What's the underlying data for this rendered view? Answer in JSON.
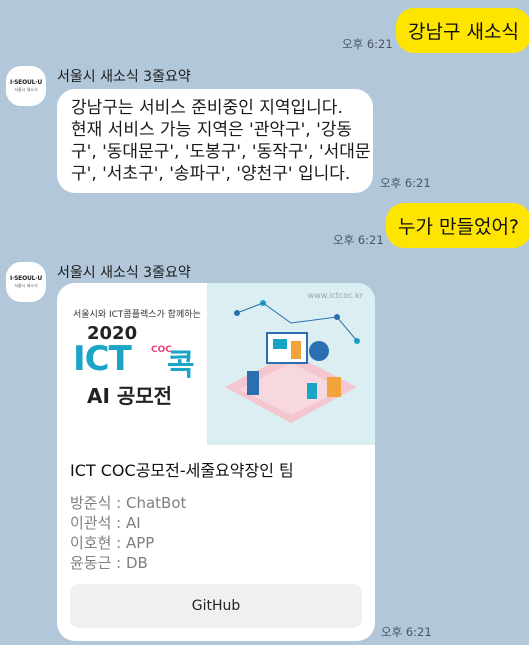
{
  "messages": {
    "me1": {
      "text": "강남구 새소식",
      "time": "오후 6:21"
    },
    "bot1": {
      "sender": "서울시 새소식 3줄요약",
      "lines": [
        "강남구는 서비스 준비중인 지역입니다.",
        "현재 서비스 가능 지역은 '관악구', '강동",
        "구', '동대문구', '도봉구', '동작구', '서대문",
        "구', '서초구', '송파구', '양천구' 입니다."
      ],
      "time": "오후 6:21"
    },
    "me2": {
      "text": "누가 만들었어?",
      "time": "오후 6:21"
    },
    "bot2": {
      "sender": "서울시 새소식 3줄요약",
      "banner": {
        "url": "www.ictcoc.kr",
        "subtitle": "서울시와 ICT콤플렉스가 함께하는",
        "year": "2020",
        "ict": "ICT",
        "coc": "COC",
        "kong": "콕",
        "ai": "AI 공모전"
      },
      "card_title": "ICT COC공모전-세줄요약장인 팀",
      "members": [
        "방준식 : ChatBot",
        "이관석 : AI",
        "이호현 : APP",
        "윤동근 : DB"
      ],
      "button_label": "GitHub",
      "time": "오후 6:21"
    }
  },
  "avatar": {
    "line1": "I·SEOUL·U",
    "line2": "서울시 새소식"
  },
  "colors": {
    "background": "#b2c7d9",
    "my_bubble": "#fee500",
    "bot_bubble": "#ffffff",
    "accent": "#1aa5c8"
  }
}
